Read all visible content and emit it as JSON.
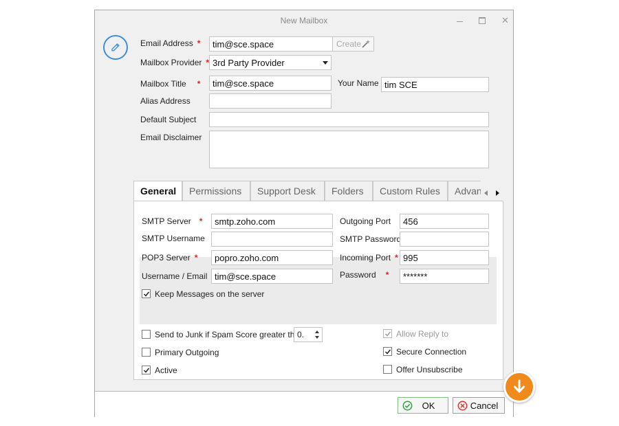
{
  "window": {
    "title": "New Mailbox"
  },
  "form": {
    "email_address_label": "Email Address",
    "email_address_value": "tim@sce.space",
    "create_label": "Create",
    "mailbox_provider_label": "Mailbox Provider",
    "mailbox_provider_value": "3rd Party Provider",
    "mailbox_title_label": "Mailbox Title",
    "mailbox_title_value": "tim@sce.space",
    "your_name_label": "Your Name",
    "your_name_value": "tim SCE",
    "alias_address_label": "Alias Address",
    "alias_address_value": "",
    "default_subject_label": "Default Subject",
    "default_subject_value": "",
    "email_disclaimer_label": "Email Disclaimer",
    "email_disclaimer_value": "",
    "required_mark": "*"
  },
  "tabs": [
    {
      "label": "General"
    },
    {
      "label": "Permissions"
    },
    {
      "label": "Support Desk"
    },
    {
      "label": "Folders"
    },
    {
      "label": "Custom Rules"
    },
    {
      "label": "Advanced"
    }
  ],
  "general": {
    "smtp_server_label": "SMTP Server",
    "smtp_server_value": "smtp.zoho.com",
    "outgoing_port_label": "Outgoing Port",
    "outgoing_port_value": "456",
    "smtp_username_label": "SMTP Username",
    "smtp_username_value": "",
    "smtp_password_label": "SMTP Password",
    "smtp_password_value": "",
    "pop3_server_label": "POP3 Server",
    "pop3_server_value": "popro.zoho.com",
    "incoming_port_label": "Incoming Port",
    "incoming_port_value": "995",
    "username_email_label": "Username / Email",
    "username_email_value": "tim@sce.space",
    "password_label": "Password",
    "password_value": "*******",
    "keep_messages_label": "Keep Messages on the server",
    "keep_messages_checked": true
  },
  "options": {
    "send_to_junk_label": "Send to Junk if Spam Score greater than",
    "send_to_junk_checked": false,
    "spam_score_value": "0.",
    "primary_outgoing_label": "Primary Outgoing",
    "primary_outgoing_checked": false,
    "active_label": "Active",
    "active_checked": true,
    "allow_reply_to_label": "Allow Reply to",
    "allow_reply_to_checked": true,
    "secure_connection_label": "Secure Connection",
    "secure_connection_checked": true,
    "offer_unsubscribe_label": "Offer Unsubscribe",
    "offer_unsubscribe_checked": false
  },
  "buttons": {
    "ok_label": "OK",
    "cancel_label": "Cancel"
  },
  "colors": {
    "accent_blue": "#3b8fd9",
    "required_red": "#e02020",
    "highlight_orange": "#f08a1c",
    "ok_green": "#2e9e3e",
    "cancel_red": "#d9342b"
  }
}
